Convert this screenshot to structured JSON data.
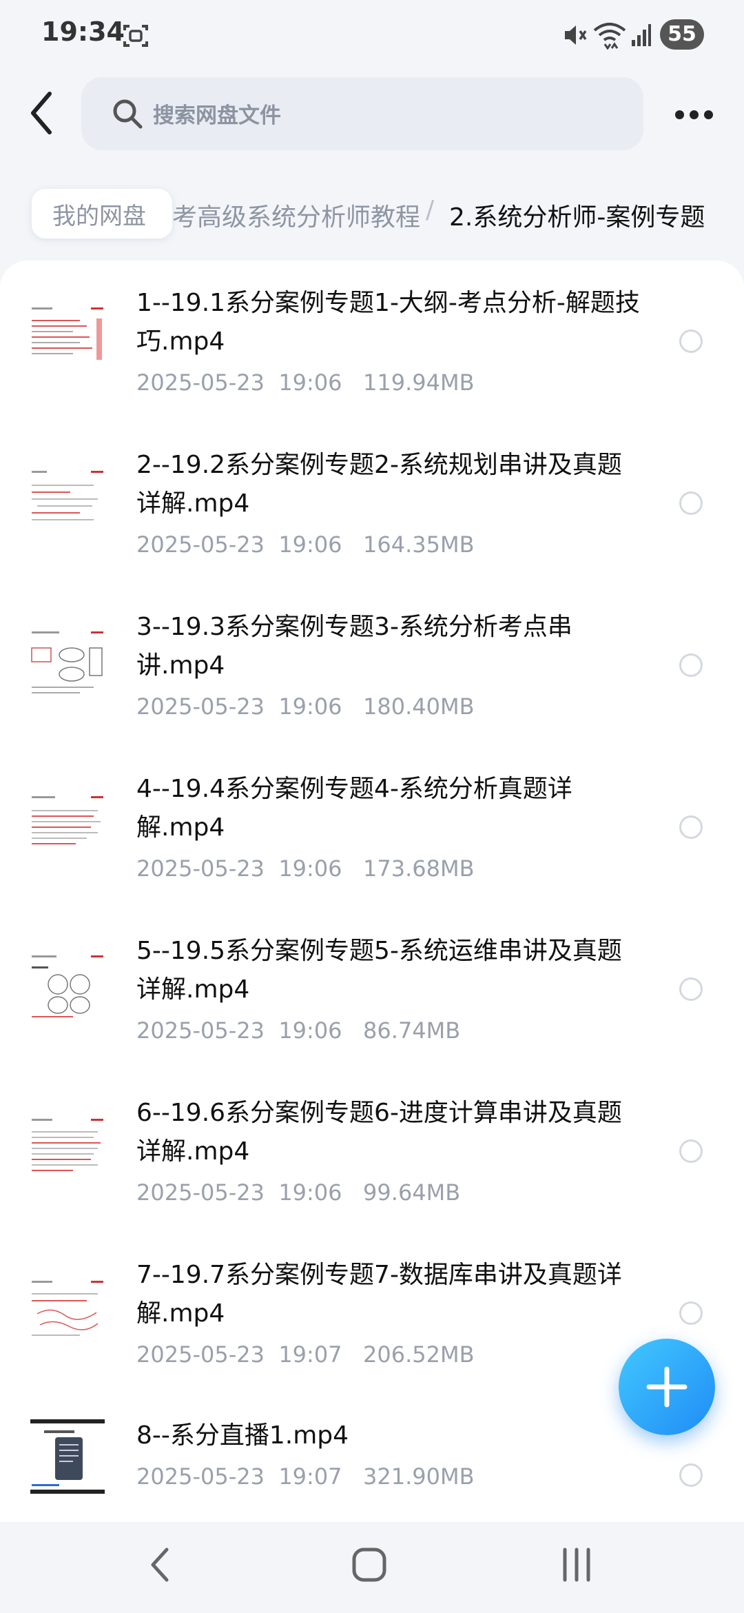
{
  "status_bar": {
    "time": "19:34",
    "battery": "55"
  },
  "search": {
    "placeholder": "搜索网盘文件"
  },
  "breadcrumb": {
    "root": "我的网盘",
    "middle": "考高级系统分析师教程",
    "separator": "/",
    "current": "2.系统分析师-案例专题"
  },
  "files": [
    {
      "name": "1--19.1系分案例专题1-大纲-考点分析-解题技巧.mp4",
      "date": "2025-05-23  19:06",
      "size": "119.94MB"
    },
    {
      "name": "2--19.2系分案例专题2-系统规划串讲及真题详解.mp4",
      "date": "2025-05-23  19:06",
      "size": "164.35MB"
    },
    {
      "name": "3--19.3系分案例专题3-系统分析考点串讲.mp4",
      "date": "2025-05-23  19:06",
      "size": "180.40MB"
    },
    {
      "name": "4--19.4系分案例专题4-系统分析真题详解.mp4",
      "date": "2025-05-23  19:06",
      "size": "173.68MB"
    },
    {
      "name": "5--19.5系分案例专题5-系统运维串讲及真题详解.mp4",
      "date": "2025-05-23  19:06",
      "size": "86.74MB"
    },
    {
      "name": "6--19.6系分案例专题6-进度计算串讲及真题详解.mp4",
      "date": "2025-05-23  19:06",
      "size": "99.64MB"
    },
    {
      "name": "7--19.7系分案例专题7-数据库串讲及真题详解.mp4",
      "date": "2025-05-23  19:07",
      "size": "206.52MB"
    },
    {
      "name": "8--系分直播1.mp4",
      "date": "2025-05-23  19:07",
      "size": "321.90MB"
    }
  ],
  "icons": {
    "status": [
      "screenshot-icon",
      "mute-icon",
      "wifi-icon",
      "signal-icon"
    ],
    "header": [
      "back-icon",
      "search-icon",
      "more-icon"
    ],
    "fab": "plus-icon",
    "nav": [
      "nav-back-icon",
      "nav-home-icon",
      "nav-recents-icon"
    ]
  },
  "colors": {
    "accent": "#1f8cf5",
    "fab_light": "#43c8ff",
    "muted_text": "#9aa0ab"
  }
}
